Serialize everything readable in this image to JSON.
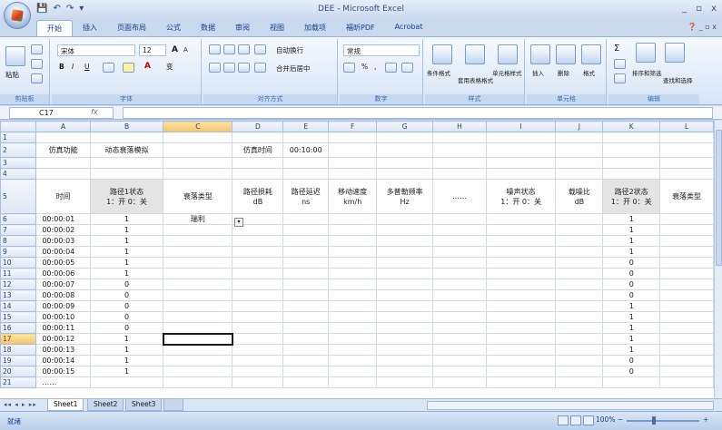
{
  "window": {
    "title": "DEE - Microsoft Excel",
    "controls": [
      "_",
      "▫",
      "x"
    ]
  },
  "qat": [
    "💾",
    "↶",
    "↷",
    "▾"
  ],
  "tabs": [
    "开始",
    "插入",
    "页面布局",
    "公式",
    "数据",
    "审阅",
    "视图",
    "加载项",
    "福昕PDF",
    "Acrobat"
  ],
  "ribbon": {
    "paste_label": "粘贴",
    "font_name": "宋体",
    "font_size": "12",
    "grow": "A",
    "shrink": "A",
    "bold": "B",
    "italic": "I",
    "underline": "U",
    "font_color": "A",
    "wen": "变",
    "wrap_text": "自动换行",
    "merge_center": "合并后居中",
    "number_format": "常规",
    "percent": "%",
    "comma": ",",
    "sigma": "Σ",
    "cond_format": "条件格式",
    "table_format": "套用表格格式",
    "cell_style": "单元格样式",
    "insert": "插入",
    "delete": "删除",
    "format": "格式",
    "sort_filter": "排序和筛选",
    "find_select": "查找和选择",
    "groups": {
      "clipboard": "剪贴板",
      "font": "字体",
      "alignment": "对齐方式",
      "number": "数字",
      "styles": "样式",
      "cells": "单元格",
      "editing": "编辑"
    }
  },
  "formula_bar": {
    "name_box": "C17",
    "fx": "fx",
    "value": ""
  },
  "columns": [
    "A",
    "B",
    "C",
    "D",
    "E",
    "F",
    "G",
    "H",
    "I",
    "J",
    "K",
    "L"
  ],
  "selected_column": "C",
  "selected_row": "17",
  "rows": [
    {
      "n": "1",
      "cells": [
        "",
        "",
        "",
        "",
        "",
        "",
        "",
        "",
        "",
        "",
        "",
        ""
      ]
    },
    {
      "n": "2",
      "cells": [
        "仿真功能",
        "动态衰落模拟",
        "",
        "仿真时间",
        "00:10:00",
        "",
        "",
        "",
        "",
        "",
        "",
        ""
      ]
    },
    {
      "n": "3",
      "cells": [
        "",
        "",
        "",
        "",
        "",
        "",
        "",
        "",
        "",
        "",
        "",
        ""
      ]
    },
    {
      "n": "4",
      "cells": [
        "",
        "",
        "",
        "",
        "",
        "",
        "",
        "",
        "",
        "",
        "",
        ""
      ]
    },
    {
      "n": "5",
      "cells": [
        "时间",
        "路径1状态\n1：开 0：关",
        "衰落类型",
        "路径损耗\ndB",
        "路径延迟\nns",
        "移动速度\nkm/h",
        "多普勒频率\nHz",
        "……",
        "噪声状态\n1：开 0：关",
        "载噪比\ndB",
        "路径2状态\n1：开 0：关",
        "衰落类型"
      ]
    },
    {
      "n": "6",
      "cells": [
        "00:00:01",
        "1",
        "瑞利",
        "",
        "",
        "",
        "",
        "",
        "",
        "",
        "1",
        ""
      ]
    },
    {
      "n": "7",
      "cells": [
        "00:00:02",
        "1",
        "",
        "",
        "",
        "",
        "",
        "",
        "",
        "",
        "1",
        ""
      ]
    },
    {
      "n": "8",
      "cells": [
        "00:00:03",
        "1",
        "",
        "",
        "",
        "",
        "",
        "",
        "",
        "",
        "1",
        ""
      ]
    },
    {
      "n": "9",
      "cells": [
        "00:00:04",
        "1",
        "",
        "",
        "",
        "",
        "",
        "",
        "",
        "",
        "1",
        ""
      ]
    },
    {
      "n": "10",
      "cells": [
        "00:00:05",
        "1",
        "",
        "",
        "",
        "",
        "",
        "",
        "",
        "",
        "0",
        ""
      ]
    },
    {
      "n": "11",
      "cells": [
        "00:00:06",
        "1",
        "",
        "",
        "",
        "",
        "",
        "",
        "",
        "",
        "0",
        ""
      ]
    },
    {
      "n": "12",
      "cells": [
        "00:00:07",
        "0",
        "",
        "",
        "",
        "",
        "",
        "",
        "",
        "",
        "0",
        ""
      ]
    },
    {
      "n": "13",
      "cells": [
        "00:00:08",
        "0",
        "",
        "",
        "",
        "",
        "",
        "",
        "",
        "",
        "0",
        ""
      ]
    },
    {
      "n": "14",
      "cells": [
        "00:00:09",
        "0",
        "",
        "",
        "",
        "",
        "",
        "",
        "",
        "",
        "1",
        ""
      ]
    },
    {
      "n": "15",
      "cells": [
        "00:00:10",
        "0",
        "",
        "",
        "",
        "",
        "",
        "",
        "",
        "",
        "1",
        ""
      ]
    },
    {
      "n": "16",
      "cells": [
        "00:00:11",
        "0",
        "",
        "",
        "",
        "",
        "",
        "",
        "",
        "",
        "1",
        ""
      ]
    },
    {
      "n": "17",
      "cells": [
        "00:00:12",
        "1",
        "",
        "",
        "",
        "",
        "",
        "",
        "",
        "",
        "1",
        ""
      ]
    },
    {
      "n": "18",
      "cells": [
        "00:00:13",
        "1",
        "",
        "",
        "",
        "",
        "",
        "",
        "",
        "",
        "1",
        ""
      ]
    },
    {
      "n": "19",
      "cells": [
        "00:00:14",
        "1",
        "",
        "",
        "",
        "",
        "",
        "",
        "",
        "",
        "0",
        ""
      ]
    },
    {
      "n": "20",
      "cells": [
        "00:00:15",
        "1",
        "",
        "",
        "",
        "",
        "",
        "",
        "",
        "",
        "0",
        ""
      ]
    },
    {
      "n": "21",
      "cells": [
        "……",
        "",
        "",
        "",
        "",
        "",
        "",
        "",
        "",
        "",
        "",
        ""
      ]
    }
  ],
  "sheets": [
    "Sheet1",
    "Sheet2",
    "Sheet3"
  ],
  "status": {
    "ready": "就绪",
    "zoom": "100%",
    "zoom_minus": "−",
    "zoom_plus": "+"
  }
}
